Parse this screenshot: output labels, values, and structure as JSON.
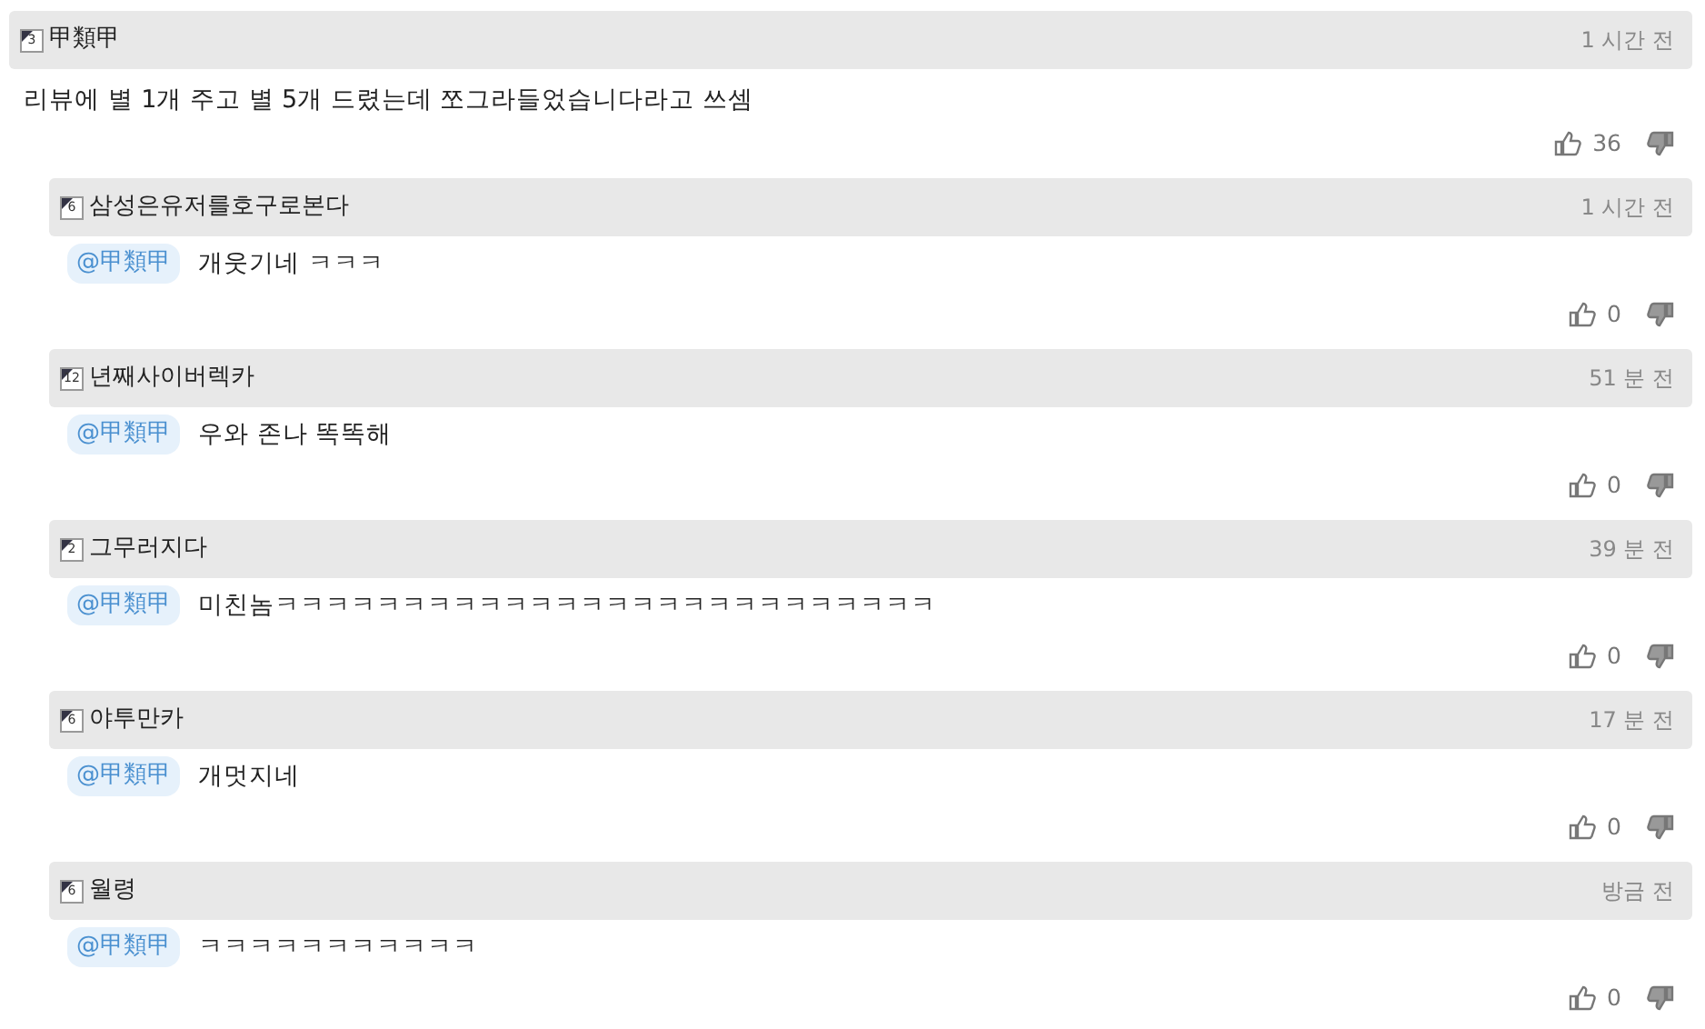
{
  "comment": {
    "rank": "3",
    "author": "甲類甲",
    "time": "1 시간 전",
    "text": "리뷰에 별 1개 주고 별 5개 드렸는데 쪼그라들었습니다라고 쓰셈",
    "likes": "36"
  },
  "replies": [
    {
      "rank": "6",
      "author": "삼성은유저를호구로본다",
      "time": "1 시간 전",
      "mention": "@甲類甲",
      "text": "개웃기네 ㅋㅋㅋ",
      "likes": "0"
    },
    {
      "rank": "12",
      "author": "년째사이버렉카",
      "time": "51 분 전",
      "mention": "@甲類甲",
      "text": "우와 존나 똑똑해",
      "likes": "0"
    },
    {
      "rank": "2",
      "author": "그무러지다",
      "time": "39 분 전",
      "mention": "@甲類甲",
      "text": "미친놈ㅋㅋㅋㅋㅋㅋㅋㅋㅋㅋㅋㅋㅋㅋㅋㅋㅋㅋㅋㅋㅋㅋㅋㅋㅋㅋ",
      "likes": "0"
    },
    {
      "rank": "6",
      "author": "야투만카",
      "time": "17 분 전",
      "mention": "@甲類甲",
      "text": "개멋지네",
      "likes": "0"
    },
    {
      "rank": "6",
      "author": "월령",
      "time": "방금 전",
      "mention": "@甲類甲",
      "text": "ㅋㅋㅋㅋㅋㅋㅋㅋㅋㅋㅋ",
      "likes": "0"
    }
  ]
}
